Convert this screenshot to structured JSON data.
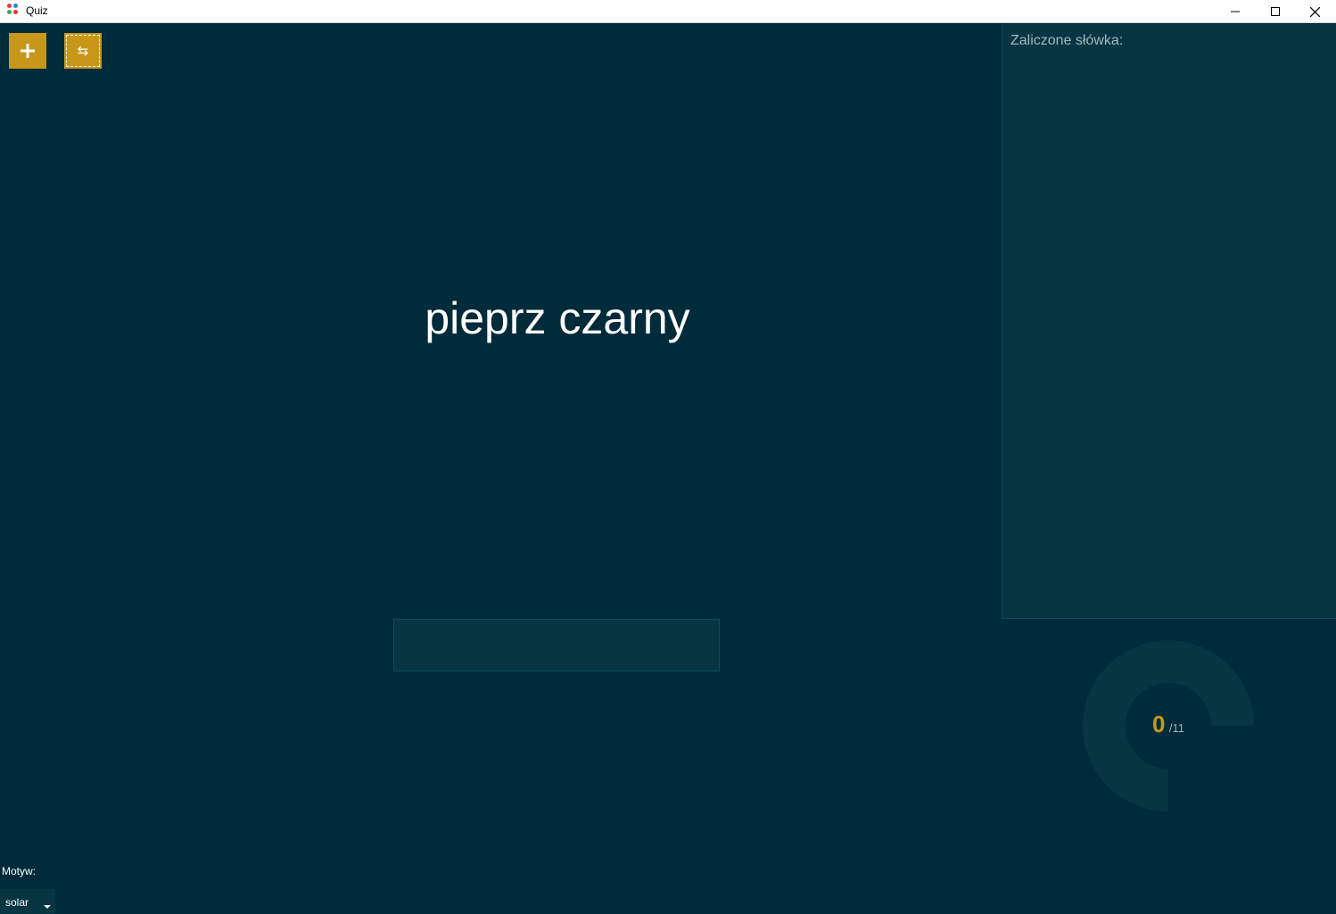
{
  "window": {
    "title": "Quiz",
    "icon": "app-dots-icon",
    "controls": [
      "minimize-icon",
      "maximize-icon",
      "close-icon"
    ]
  },
  "toolbar": {
    "add_icon": "plus-icon",
    "swap_icon": "swap-arrows-icon",
    "swap_glyph": "⇆"
  },
  "quiz": {
    "prompt_word": "pieprz czarny",
    "answer_value": "",
    "answer_placeholder": ""
  },
  "passed_panel": {
    "title": "Zaliczone słówka:",
    "items": []
  },
  "progress": {
    "count": "0",
    "total": "/11",
    "fraction": 0.75
  },
  "theme": {
    "label": "Motyw:",
    "selected": "solar"
  },
  "colors": {
    "background": "#002b3a",
    "panel": "#073542",
    "accent": "#c8971a"
  }
}
